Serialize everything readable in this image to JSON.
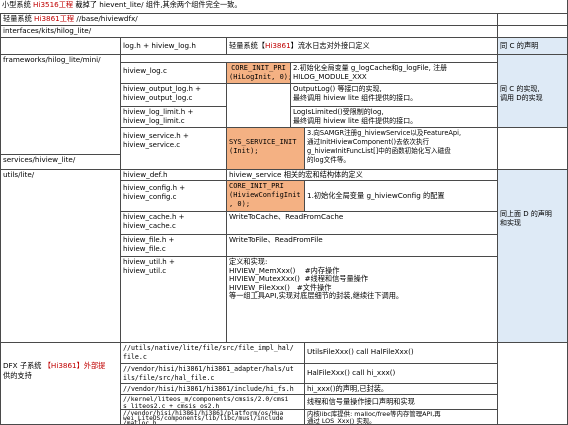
{
  "header": {
    "intro_pre": "小型系统 ",
    "intro_chip": "Hi3516工程",
    "intro_post": " 裁掉了 hievent_lite/ 组件,其余两个组件完全一致。",
    "light_pre": "轻量系统 ",
    "light_chip": "Hi3861工程",
    "light_path": " //base/hiviewdfx/"
  },
  "interfaces": {
    "path": "interfaces/kits/hilog_lite/",
    "file": "log.h + hiview_log.h",
    "desc_pre": "轻量系统【",
    "desc_chip": "Hi3861",
    "desc_post": "】流水日志对外接口定义",
    "note": "同 C 的声明"
  },
  "frameworks": {
    "path": "frameworks/hilog_lite/mini/",
    "hiview_log_file": "hiview_log.c",
    "init_macro": "CORE_INIT_PRI\n(HiLogInit, 0);",
    "init_desc": "2.初始化全局变量 g_logCache和g_logFile, 注册\nHILOG_MODULE_XXX",
    "output_file": "hiview_output_log.h +\nhiview_output_log.c",
    "output_desc": "OutputLog() 等接口的实现,\n最终调用 hiview lite 组件提供的接口。",
    "limit_file": "hiview_log_limit.h +\nhiview_log_limit.c",
    "limit_desc": "LogIsLimited()受限制的log,\n最终调用 hiview lite 组件提供的接口。",
    "note": "同 C 的实现,\n调用 D的实现"
  },
  "services": {
    "path": "services/hiview_lite/",
    "service_file": "hiview_service.h +\nhiview_service.c",
    "service_macro": "SYS_SERVICE_INIT\n(Init);",
    "service_desc": "3.向SAMGR注册g_hiviewService以及FeatureApi,\n通过InitHiviewComponent()去依次执行\ng_hiviewInitFuncList[]中的函数初始化写入磁盘\n的log文件等。"
  },
  "utils": {
    "path": "utils/lite/",
    "def_file": "hiview_def.h",
    "def_desc": "hiview_service 相关的宏和结构体的定义",
    "config_file": "hiview_config.h +\nhiview_config.c",
    "config_macro": "CORE_INIT_PRI\n(HiviewConfigInit\n, 0);",
    "config_desc": "1.初始化全局变量 g_hiviewConfig 的配置",
    "cache_file": "hiview_cache.h +\nhiview_cache.c",
    "cache_desc": "WriteToCache、ReadFromCache",
    "file_file": "hiview_file.h +\nhiview_file.c",
    "file_desc": "WriteToFile、ReadFromFile",
    "util_file": "hiview_util.h +\nhiview_util.c",
    "util_title": "定义和实现:",
    "util_lines": [
      "HIVIEW_MemXxx()    #内存操作",
      "HIVIEW_MutexXxx()  #线程和信号量操作",
      "HIVIEW_FileXxx()   #文件操作"
    ],
    "util_footer": "等一组工具API,实现对底层细节的封装,继续往下调用。",
    "note": "同上面 D 的声明\n和实现"
  },
  "dfx": {
    "title_pre": "DFX 子系统 ",
    "title_chip": "【Hi3861】外部提",
    "title_post": "供的支持",
    "rows": [
      {
        "path": "//utils/native/lite/file/src/file_impl_hal/\nfile.c",
        "desc": "UtilsFileXxx() call HalFileXxx()"
      },
      {
        "path": "//vendor/hisi/hi3861/hi3861_adapter/hals/ut\nils/file/src/hal_file.c",
        "desc": "HalFileXxx() call hi_xxx()"
      },
      {
        "path": "//vendor/hisi/hi3861/hi3861/include/hi_fs.h",
        "desc": "hi_xxx()的声明,已封装。"
      },
      {
        "path": "//kernel/liteos_m/components/cmsis/2.0/cmsi\ns_liteos2.c + cmsis_os2.h",
        "desc": "线程和信号量操作接口声明和实现"
      },
      {
        "path": "//vendor/hisi/hi3861/hi3861/platform/os/Hua\nwei_LiteOS/components/lib/libc/musl/include\n/malloc.h",
        "desc": "内核libc库提供: malloc/free等内存管理API,再\n通过 LOS_Xxx() 实现。"
      }
    ]
  },
  "colors": {
    "highlight_red": "#c00000",
    "macro_orange": "#f4b183",
    "note_blue": "#deeaf6",
    "grid_line": "#4a4a4a"
  }
}
